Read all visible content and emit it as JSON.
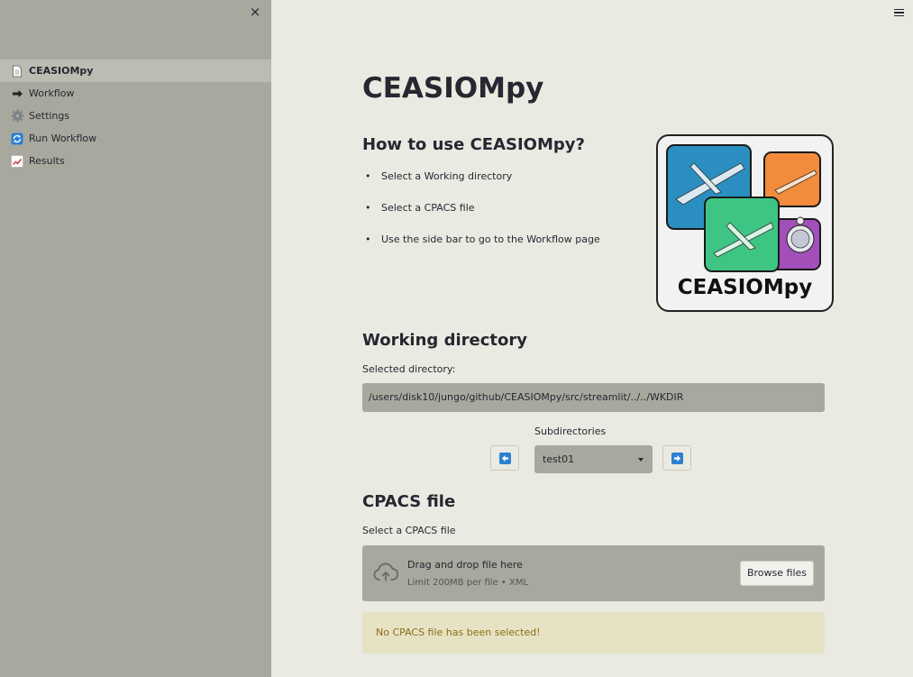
{
  "sidebar": {
    "close_label": "×",
    "items": [
      {
        "label": "CEASIOMpy",
        "icon": "document-icon",
        "active": true
      },
      {
        "label": "Workflow",
        "icon": "arrow-right-icon",
        "active": false
      },
      {
        "label": "Settings",
        "icon": "gear-icon",
        "active": false
      },
      {
        "label": "Run Workflow",
        "icon": "refresh-icon",
        "active": false
      },
      {
        "label": "Results",
        "icon": "chart-icon",
        "active": false
      }
    ]
  },
  "main": {
    "title": "CEASIOMpy",
    "how_to": {
      "title": "How to use CEASIOMpy?",
      "steps": [
        "Select a Working directory",
        "Select a CPACS file",
        "Use the side bar to go to the Workflow page"
      ]
    },
    "logo": {
      "text": "CEASIOMpy"
    },
    "working_directory": {
      "title": "Working directory",
      "selected_label": "Selected directory:",
      "path": "/users/disk10/jungo/github/CEASIOMpy/src/streamlit/../../WKDIR",
      "subdirectories_label": "Subdirectories",
      "selected_subdir": "test01"
    },
    "cpacs": {
      "title": "CPACS file",
      "select_label": "Select a CPACS file",
      "drop_text": "Drag and drop file here",
      "limit_text": "Limit 200MB per file • XML",
      "browse_label": "Browse files",
      "warning": "No CPACS file has been selected!"
    }
  },
  "colors": {
    "sidebar_bg": "#a8a89e",
    "main_bg": "#eaeae2",
    "accent_blue": "#2d7fd1",
    "warning_bg": "#e6e3c5",
    "warning_text": "#8c6d12"
  }
}
